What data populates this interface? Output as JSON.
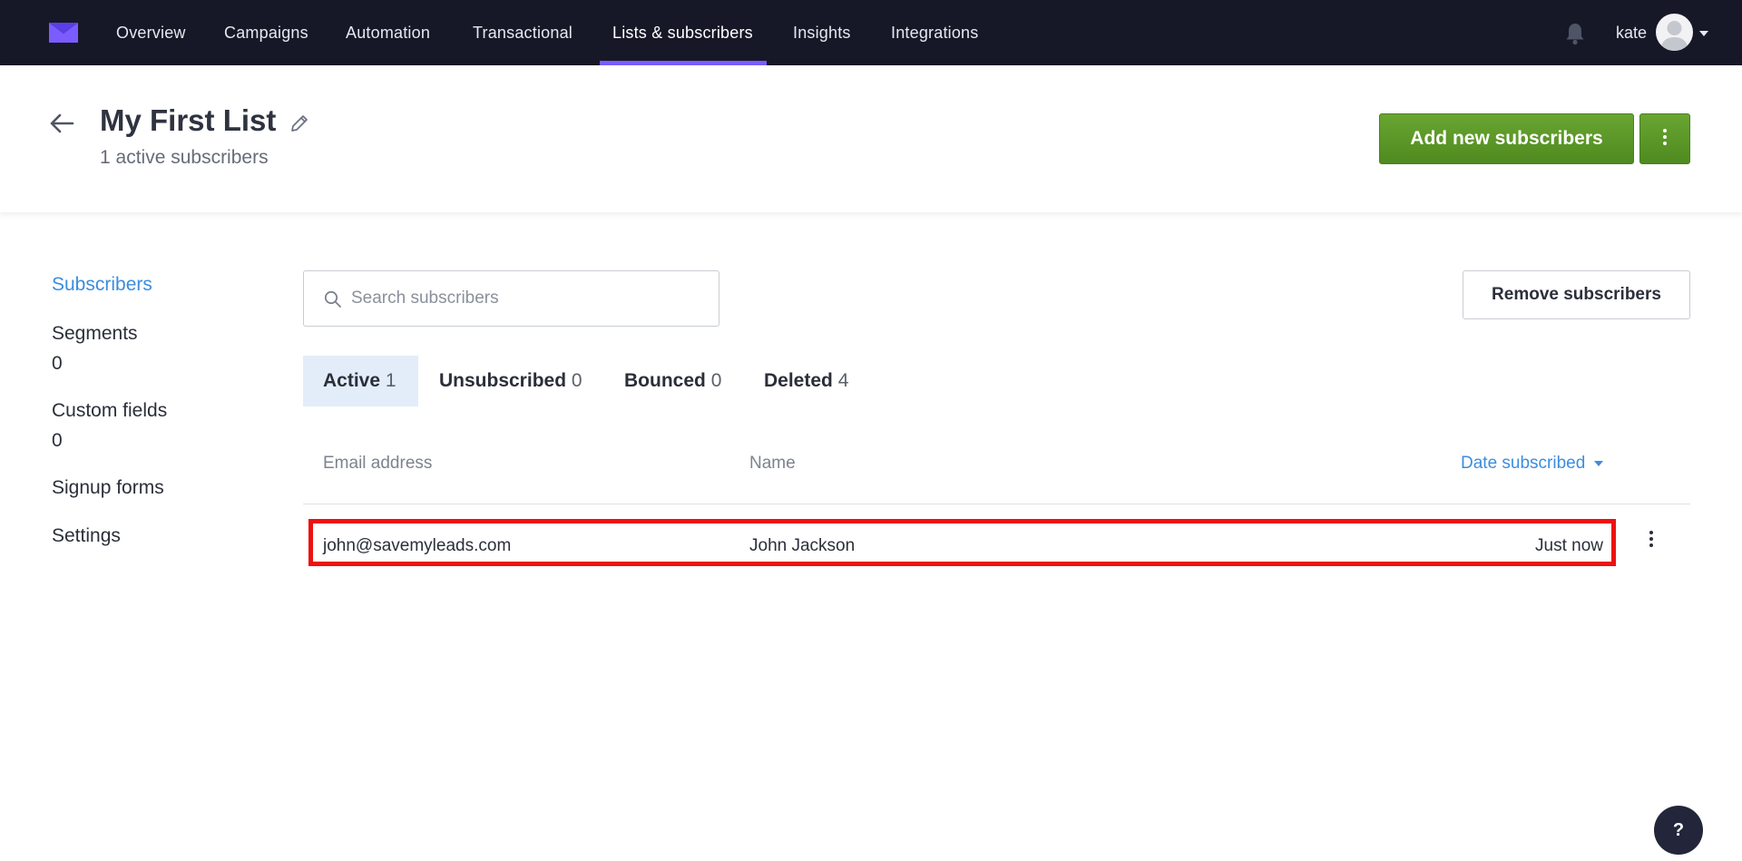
{
  "nav": {
    "items": [
      {
        "label": "Overview"
      },
      {
        "label": "Campaigns"
      },
      {
        "label": "Automation"
      },
      {
        "label": "Transactional"
      },
      {
        "label": "Lists & subscribers"
      },
      {
        "label": "Insights"
      },
      {
        "label": "Integrations"
      }
    ],
    "active_item": "Lists & subscribers",
    "user": {
      "name": "kate"
    }
  },
  "header": {
    "title": "My First List",
    "subtitle": "1 active subscribers",
    "add_button": "Add new subscribers"
  },
  "sidebar": {
    "items": [
      {
        "label": "Subscribers"
      },
      {
        "label": "Segments",
        "count": "0"
      },
      {
        "label": "Custom fields",
        "count": "0"
      },
      {
        "label": "Signup forms"
      },
      {
        "label": "Settings"
      }
    ],
    "active_item": "Subscribers"
  },
  "search": {
    "placeholder": "Search subscribers",
    "value": ""
  },
  "remove_button": "Remove subscribers",
  "tabs": [
    {
      "label": "Active",
      "count": "1"
    },
    {
      "label": "Unsubscribed",
      "count": "0"
    },
    {
      "label": "Bounced",
      "count": "0"
    },
    {
      "label": "Deleted",
      "count": "4"
    }
  ],
  "active_tab": "Active",
  "table": {
    "headers": [
      "Email address",
      "Name",
      "Date subscribed"
    ],
    "sorted_by": "Date subscribed",
    "rows": [
      {
        "email": "john@savemyleads.com",
        "name": "John Jackson",
        "date": "Just now",
        "highlighted": true
      }
    ]
  },
  "help_button": "?",
  "colors": {
    "nav_bg": "#161827",
    "nav_active_underline": "#7b5cff",
    "primary_green": "#5a9727",
    "link_blue": "#3c8dde",
    "highlight_red": "#ee1111",
    "active_tab_bg": "#e3edf9"
  },
  "icons": {
    "logo": "mailerlite-logo-icon",
    "bell": "bell-icon",
    "back": "arrow-left-icon",
    "edit": "pencil-icon",
    "search": "search-icon",
    "more": "kebab-menu-icon"
  }
}
